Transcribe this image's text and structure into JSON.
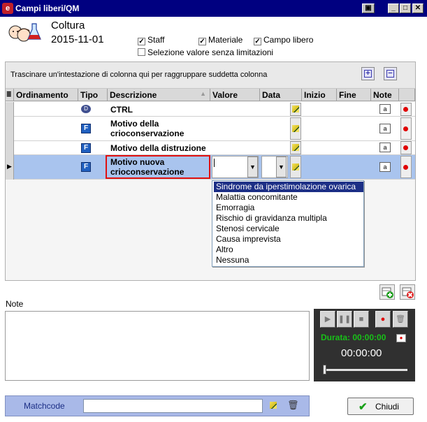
{
  "window": {
    "title": "Campi liberi/QM"
  },
  "header": {
    "title": "Coltura",
    "date": "2015-11-01"
  },
  "options": {
    "staff": {
      "label": "Staff",
      "checked": true
    },
    "materiale": {
      "label": "Materiale",
      "checked": true
    },
    "campo_libero": {
      "label": "Campo libero",
      "checked": true
    },
    "senza_limitazioni": {
      "label": "Selezione valore senza limitazioni",
      "checked": false
    }
  },
  "grid": {
    "group_hint": "Trascinare un'intestazione di colonna qui per raggruppare suddetta colonna",
    "columns": [
      "Ordinamento",
      "Tipo",
      "Descrizione",
      "Valore",
      "Data",
      "Inizio",
      "Fine",
      "Note"
    ],
    "rows": [
      {
        "tipo": "D",
        "descrizione": "CTRL"
      },
      {
        "tipo": "F",
        "descrizione": "Motivo della crioconservazione"
      },
      {
        "tipo": "F",
        "descrizione": "Motivo della distruzione"
      },
      {
        "tipo": "F",
        "descrizione": "Motivo nuova crioconservazione",
        "selected": true
      }
    ],
    "note_icon": "a"
  },
  "dropdown": {
    "options": [
      "Sindrome da iperstimolazione ovarica",
      "Malattia concomitante",
      "Emorragia",
      "Rischio di gravidanza multipla",
      "Stenosi cervicale",
      "Causa imprevista",
      "Altro",
      "Nessuna"
    ],
    "selected_index": 0
  },
  "notes": {
    "label": "Note",
    "value": ""
  },
  "player": {
    "duration_label": "Durata: 00:00:00",
    "time": "00:00:00",
    "progress": 0
  },
  "footer": {
    "matchcode_label": "Matchcode",
    "matchcode_value": "",
    "close_label": "Chiudi"
  },
  "colors": {
    "titlebar": "#000080",
    "selection": "#1c2f86",
    "row_selected": "#a9c4ee",
    "accent_green": "#18c018"
  }
}
